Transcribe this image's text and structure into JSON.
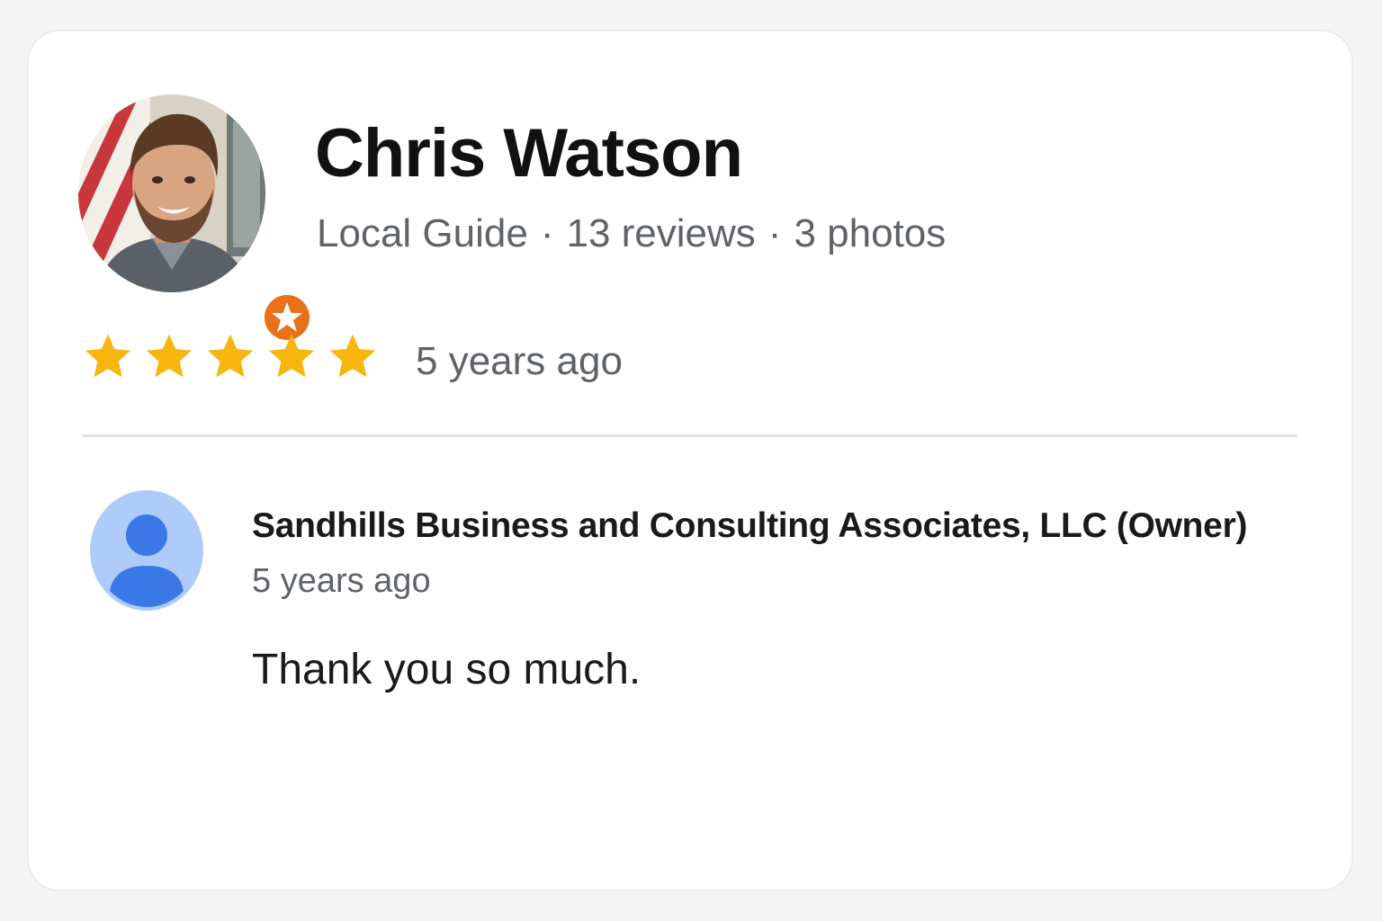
{
  "reviewer": {
    "name": "Chris Watson",
    "badge": "Local Guide",
    "separator": "·",
    "reviews": "13 reviews",
    "photos": "3 photos",
    "avatar_icon": "profile-photo",
    "badge_icon": "local-guide-star-icon",
    "badge_color": "#e8711a"
  },
  "review": {
    "rating": 5,
    "max_rating": 5,
    "time": "5 years ago",
    "star_color": "#f6b60d"
  },
  "owner_response": {
    "name": "Sandhills Business and Consulting Associates, LLC (Owner)",
    "time": "5 years ago",
    "text": "Thank you so much.",
    "avatar_icon": "default-person-icon",
    "avatar_bg_color": "#aecbfa",
    "avatar_fg_color": "#3b78e7"
  }
}
